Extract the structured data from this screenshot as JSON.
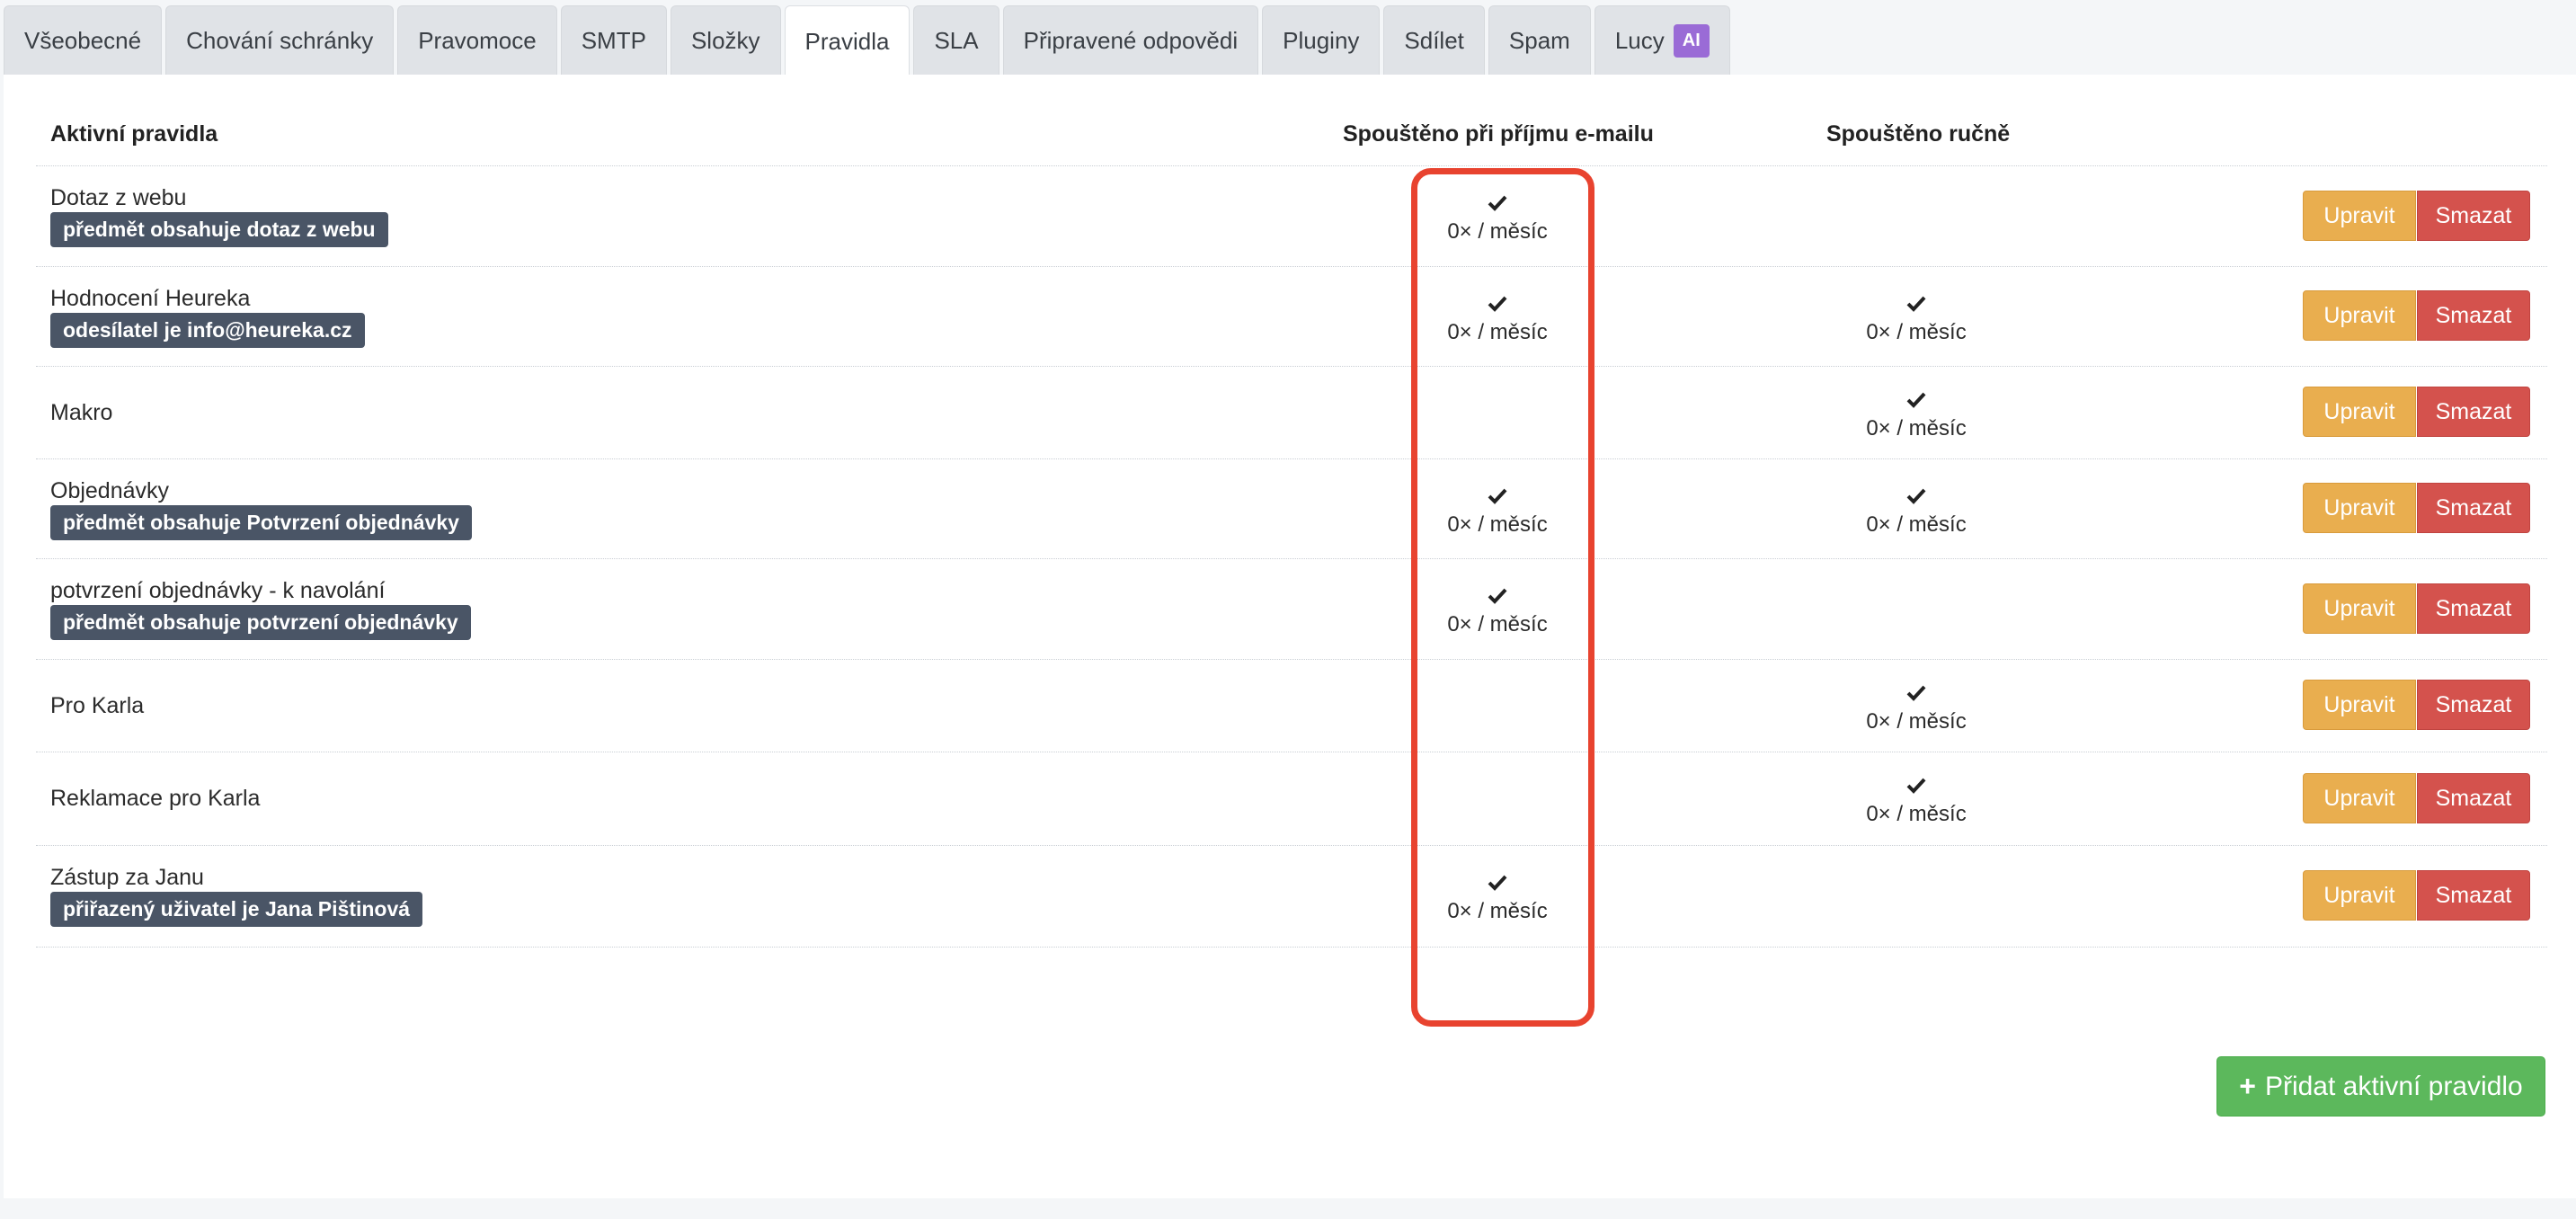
{
  "tabs": [
    {
      "label": "Všeobecné"
    },
    {
      "label": "Chování schránky"
    },
    {
      "label": "Pravomoce"
    },
    {
      "label": "SMTP"
    },
    {
      "label": "Složky"
    },
    {
      "label": "Pravidla",
      "active": true
    },
    {
      "label": "SLA"
    },
    {
      "label": "Připravené odpovědi"
    },
    {
      "label": "Pluginy"
    },
    {
      "label": "Sdílet"
    },
    {
      "label": "Spam"
    },
    {
      "label": "Lucy",
      "badge": "AI"
    }
  ],
  "table": {
    "headers": {
      "name": "Aktivní pravidla",
      "on_receive": "Spouštěno při příjmu e-mailu",
      "manual": "Spouštěno ručně"
    },
    "rows": [
      {
        "name": "Dotaz z webu",
        "condition": "předmět obsahuje dotaz z webu",
        "on_receive": "0× / měsíc",
        "manual": null
      },
      {
        "name": "Hodnocení Heureka",
        "condition": "odesílatel je info@heureka.cz",
        "on_receive": "0× / měsíc",
        "manual": "0× / měsíc"
      },
      {
        "name": "Makro",
        "condition": null,
        "on_receive": null,
        "manual": "0× / měsíc"
      },
      {
        "name": "Objednávky",
        "condition": "předmět obsahuje Potvrzení objednávky",
        "on_receive": "0× / měsíc",
        "manual": "0× / měsíc"
      },
      {
        "name": "potvrzení objednávky - k navolání",
        "condition": "předmět obsahuje potvrzení objednávky",
        "on_receive": "0× / měsíc",
        "manual": null
      },
      {
        "name": "Pro Karla",
        "condition": null,
        "on_receive": null,
        "manual": "0× / měsíc"
      },
      {
        "name": "Reklamace pro Karla",
        "condition": null,
        "on_receive": null,
        "manual": "0× / měsíc"
      },
      {
        "name": "Zástup za Janu",
        "condition": "přiřazený uživatel je Jana Pištinová",
        "on_receive": "0× / měsíc",
        "manual": null
      }
    ]
  },
  "actions": {
    "edit_label": "Upravit",
    "delete_label": "Smazat"
  },
  "add_button": {
    "label": "Přidat aktivní pravidlo",
    "icon": "plus-icon"
  },
  "colors": {
    "edit": "#e9ae4f",
    "delete": "#d4524d",
    "add": "#5cb85c",
    "condition_badge": "#4a5566",
    "ai_badge": "#9a6bd6",
    "highlight": "#e8432f"
  }
}
